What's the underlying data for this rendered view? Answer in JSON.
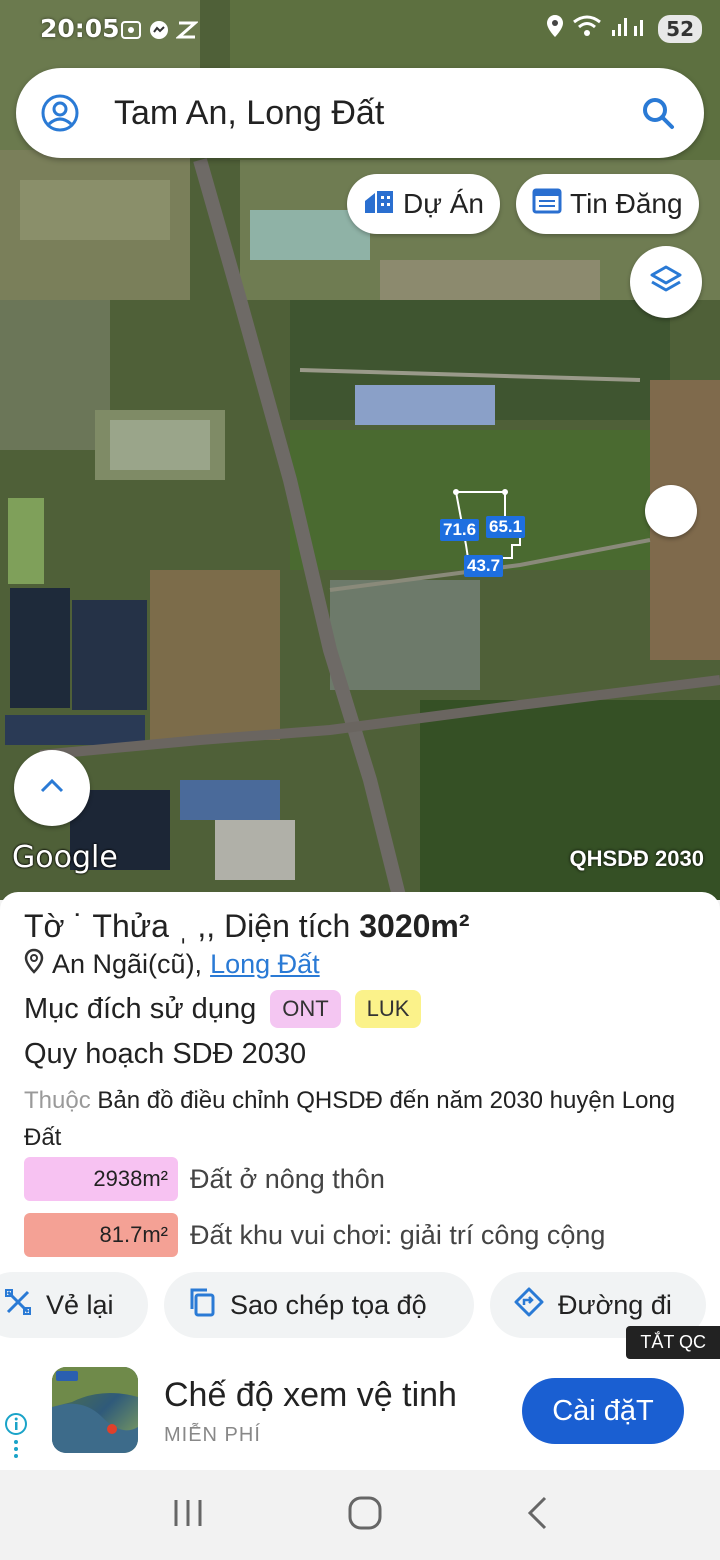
{
  "status_bar": {
    "time": "20:05",
    "battery": "52"
  },
  "search": {
    "query": "Tam An, Long Đất"
  },
  "map": {
    "chips": {
      "du_an": "Dự Án",
      "tin_dang": "Tin Đăng"
    },
    "parcel_labels": [
      "71.6",
      "65.1",
      "43.7"
    ],
    "google_logo": "Google",
    "plan_badge": "QHSDĐ 2030"
  },
  "parcel": {
    "title_prefix": "Tờ ˙ Thửa ˌ ,, Diện tích ",
    "area": "3020m²",
    "location_prefix": "An Ngãi(cũ),",
    "location_link": "Long Đất",
    "purpose_label": "Mục đích sử dụng",
    "purpose_tags": [
      {
        "code": "ONT",
        "color": "#f4c6f2"
      },
      {
        "code": "LUK",
        "color": "#fbf28a"
      }
    ],
    "plan_title": "Quy hoạch SDĐ 2030",
    "desc_prefix": "Thuộc",
    "desc_text": " Bản đồ điều chỉnh QHSDĐ đến năm 2030 huyện Long Đất",
    "zones": [
      {
        "area": "2938m²",
        "label": "Đất ở nông thôn",
        "color": "#f7c2f2"
      },
      {
        "area": "81.7m²",
        "label": "Đất khu vui chơi: giải trí công cộng",
        "color": "#f4a195"
      }
    ]
  },
  "actions": {
    "redraw": "Vẻ lại",
    "copy_coords": "Sao chép tọa độ",
    "directions": "Đường đi"
  },
  "ad": {
    "close_label": "TẮT QC",
    "title": "Chế độ xem vệ tinh",
    "subtitle": "MIỄN PHÍ",
    "cta": "Cài đặT"
  },
  "colors": {
    "accent": "#2a7ad5",
    "cta": "#1a5fd2",
    "parcel_outline": "#1e6fe0"
  }
}
